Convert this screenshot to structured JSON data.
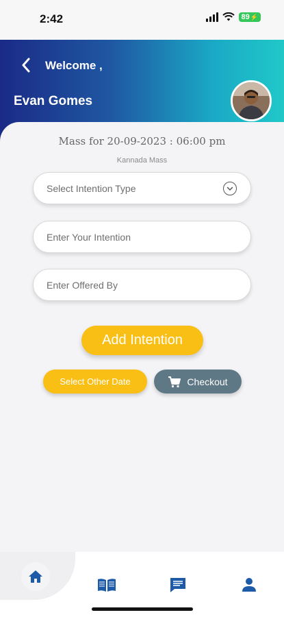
{
  "status_bar": {
    "time": "2:42",
    "battery": "89"
  },
  "header": {
    "welcome": "Welcome ,",
    "user_name": "Evan Gomes"
  },
  "mass": {
    "title": "Mass for 20-09-2023 : 06:00 pm",
    "subtitle": "Kannada Mass"
  },
  "form": {
    "intention_type_placeholder": "Select Intention Type",
    "intention_placeholder": "Enter Your Intention",
    "offered_by_placeholder": "Enter Offered By"
  },
  "actions": {
    "add_intention": "Add Intention",
    "select_other_date": "Select Other Date",
    "checkout": "Checkout"
  },
  "nav": {
    "items": [
      {
        "icon": "home-icon",
        "active": true
      },
      {
        "icon": "book-icon",
        "active": false
      },
      {
        "icon": "chat-icon",
        "active": false
      },
      {
        "icon": "profile-icon",
        "active": false
      }
    ]
  },
  "colors": {
    "header_start": "#1a2a86",
    "header_end": "#20c8c8",
    "accent_yellow": "#f9bf14",
    "checkout_gray": "#5f7885",
    "nav_blue": "#1d5aa8"
  }
}
